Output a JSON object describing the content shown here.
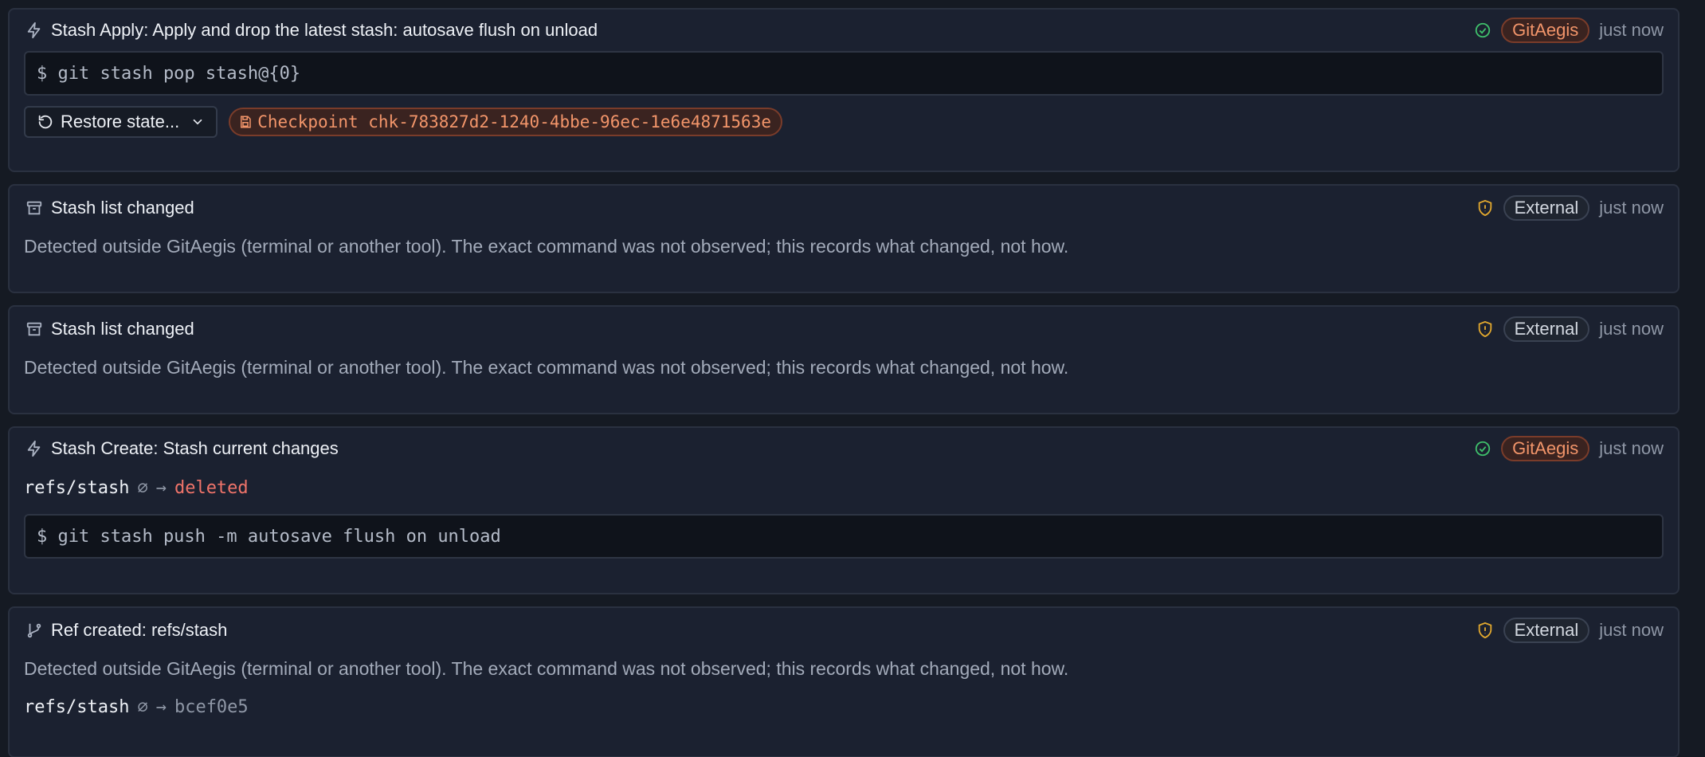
{
  "colors": {
    "background": "#151a23",
    "card": "#1b2130",
    "accent_orange": "#f2956a",
    "success_green": "#3fbf6b",
    "warning_amber": "#e0a72e",
    "deleted_red": "#f0746a"
  },
  "events": [
    {
      "icon": "bolt-icon",
      "title": "Stash Apply: Apply and drop the latest stash: autosave flush on unload",
      "status_icon": "check-circle-icon",
      "source": "GitAegis",
      "time": "just now",
      "command": "$ git stash pop stash@{0}",
      "restore_label": "Restore state...",
      "checkpoint_label": "Checkpoint chk-783827d2-1240-4bbe-96ec-1e6e4871563e"
    },
    {
      "icon": "archive-icon",
      "title": "Stash list changed",
      "status_icon": "shield-alert-icon",
      "source": "External",
      "time": "just now",
      "description": "Detected outside GitAegis (terminal or another tool). The exact command was not observed; this records what changed, not how."
    },
    {
      "icon": "archive-icon",
      "title": "Stash list changed",
      "status_icon": "shield-alert-icon",
      "source": "External",
      "time": "just now",
      "description": "Detected outside GitAegis (terminal or another tool). The exact command was not observed; this records what changed, not how."
    },
    {
      "icon": "bolt-icon",
      "title": "Stash Create: Stash current changes",
      "status_icon": "check-circle-icon",
      "source": "GitAegis",
      "time": "just now",
      "ref": "refs/stash",
      "ref_from": "∅",
      "ref_arrow": "→",
      "ref_to": "deleted",
      "command": "$ git stash push -m autosave flush on unload"
    },
    {
      "icon": "git-branch-icon",
      "title": "Ref created: refs/stash",
      "status_icon": "shield-alert-icon",
      "source": "External",
      "time": "just now",
      "description": "Detected outside GitAegis (terminal or another tool). The exact command was not observed; this records what changed, not how.",
      "ref": "refs/stash",
      "ref_from": "∅",
      "ref_arrow": "→",
      "ref_to": "bcef0e5"
    }
  ]
}
